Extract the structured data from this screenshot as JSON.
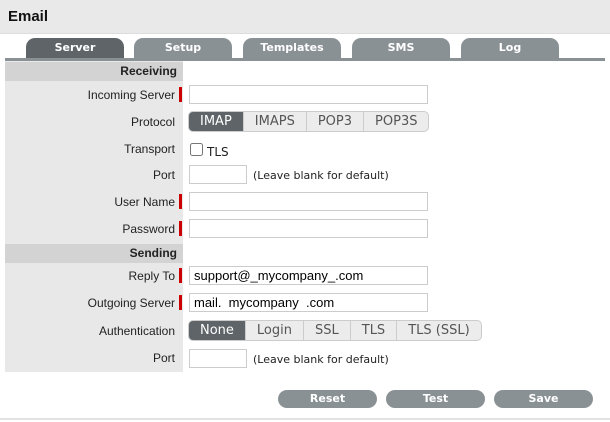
{
  "title": "Email",
  "tabs": [
    {
      "label": "Server",
      "active": true
    },
    {
      "label": "Setup"
    },
    {
      "label": "Templates"
    },
    {
      "label": "SMS"
    },
    {
      "label": "Log"
    }
  ],
  "receiving": {
    "header": "Receiving",
    "incoming_server_label": "Incoming Server",
    "incoming_server_value": "",
    "protocol_label": "Protocol",
    "protocol_options": [
      "IMAP",
      "IMAPS",
      "POP3",
      "POP3S"
    ],
    "protocol_selected": "IMAP",
    "transport_label": "Transport",
    "tls_label": "TLS",
    "tls_checked": false,
    "port_label": "Port",
    "port_value": "",
    "port_hint": "(Leave blank for default)",
    "username_label": "User Name",
    "username_value": "",
    "password_label": "Password",
    "password_value": ""
  },
  "sending": {
    "header": "Sending",
    "reply_to_label": "Reply To",
    "reply_to_value": "support@_mycompany_.com",
    "outgoing_server_label": "Outgoing Server",
    "outgoing_server_value": "mail.  mycompany  .com",
    "auth_label": "Authentication",
    "auth_options": [
      "None",
      "Login",
      "SSL",
      "TLS",
      "TLS (SSL)"
    ],
    "auth_selected": "None",
    "port_label": "Port",
    "port_value": "",
    "port_hint": "(Leave blank for default)"
  },
  "buttons": {
    "reset": "Reset",
    "test": "Test",
    "save": "Save"
  }
}
